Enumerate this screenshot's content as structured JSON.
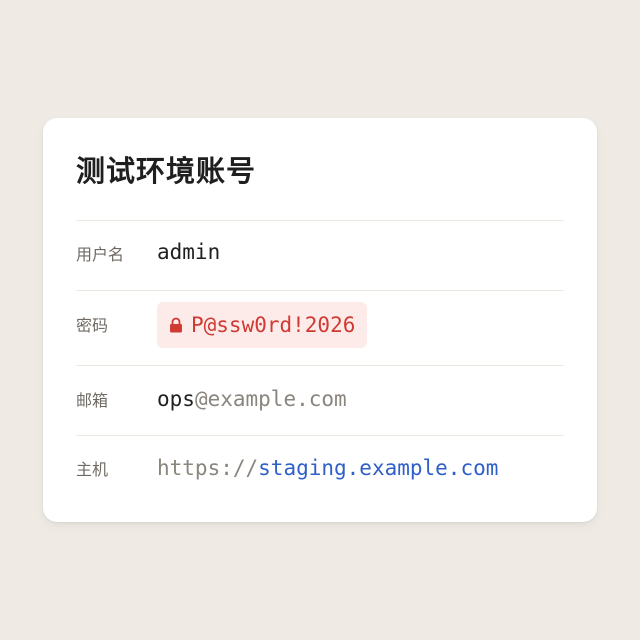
{
  "card": {
    "title": "测试环境账号",
    "fields": {
      "username": {
        "label": "用户名",
        "value": "admin"
      },
      "password": {
        "label": "密码",
        "value": "P@ssw0rd!2026",
        "icon": "lock-icon"
      },
      "email": {
        "label": "邮箱",
        "user": "ops",
        "domain": "@example.com"
      },
      "host": {
        "label": "主机",
        "scheme": "https://",
        "hostname": "staging.example.com"
      }
    }
  },
  "colors": {
    "background": "#efebe4",
    "card": "#ffffff",
    "password_bg": "#fdebea",
    "password_text": "#cf3a32",
    "link": "#2f5fc8",
    "muted": "#8a857d"
  }
}
